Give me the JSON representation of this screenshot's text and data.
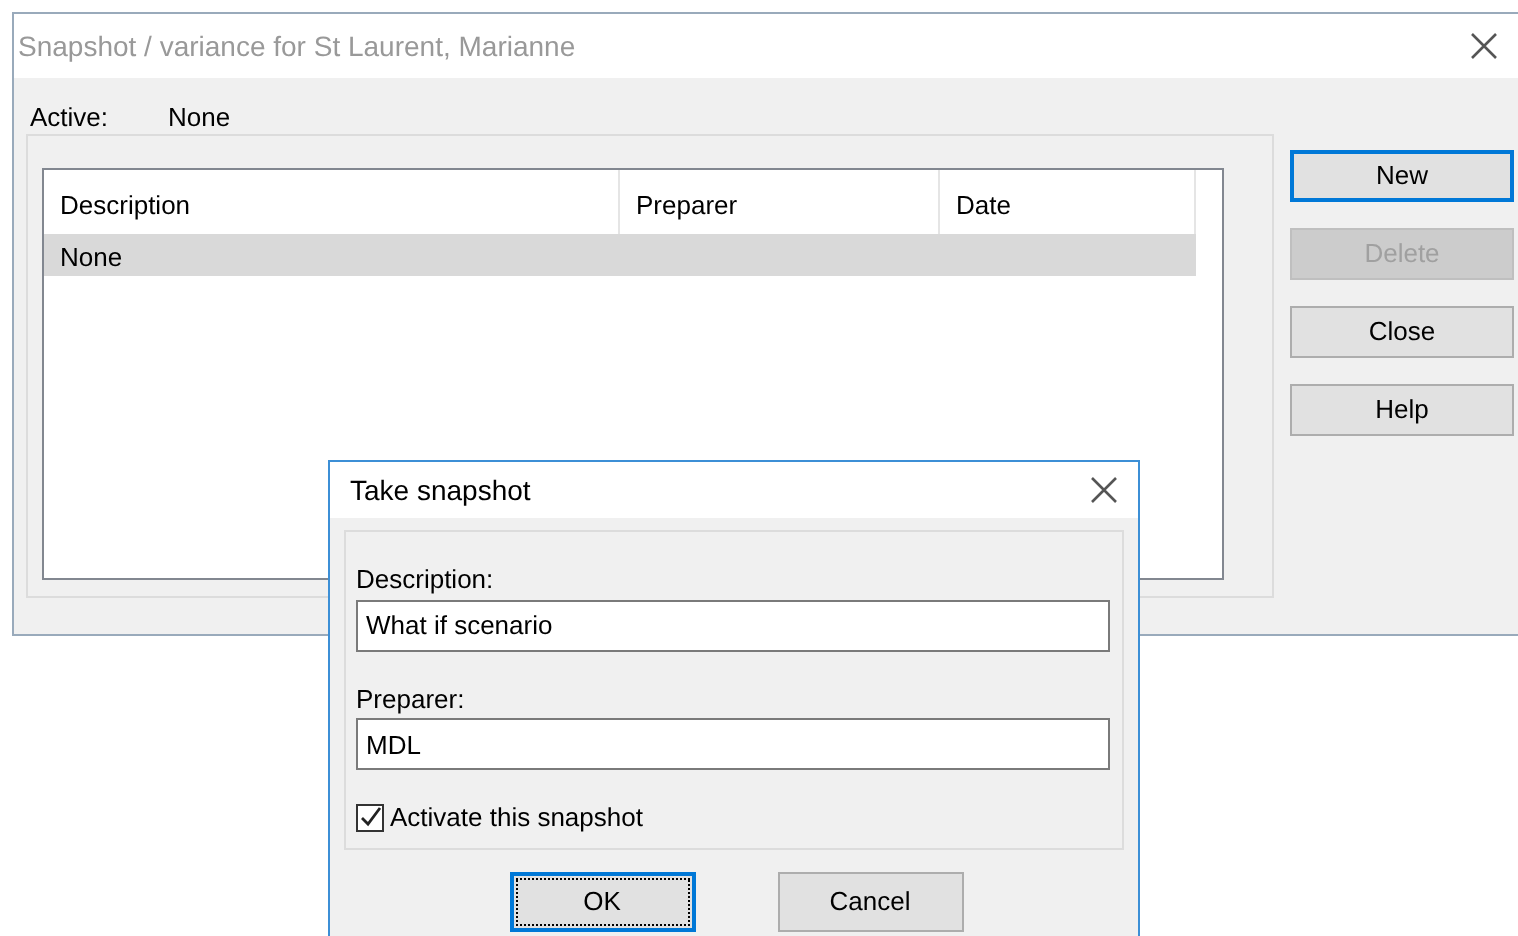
{
  "window": {
    "title": "Snapshot / variance for St Laurent, Marianne"
  },
  "active": {
    "label": "Active:",
    "value": "None"
  },
  "table": {
    "columns": [
      "Description",
      "Preparer",
      "Date"
    ],
    "rows": [
      {
        "description": "None",
        "selected": true
      }
    ]
  },
  "buttons": [
    {
      "label": "New",
      "disabled": false,
      "focused": true
    },
    {
      "label": "Delete",
      "disabled": true,
      "focused": false
    },
    {
      "label": "Close",
      "disabled": false,
      "focused": false
    },
    {
      "label": "Help",
      "disabled": false,
      "focused": false
    }
  ],
  "dialog": {
    "title": "Take snapshot",
    "fields": [
      {
        "label": "Description:",
        "value": "What if scenario"
      },
      {
        "label": "Preparer:",
        "value": "MDL"
      }
    ],
    "checkbox": {
      "label": "Activate this snapshot",
      "checked": true
    },
    "buttons": [
      {
        "label": "OK",
        "focused": true
      },
      {
        "label": "Cancel",
        "focused": false
      }
    ]
  }
}
